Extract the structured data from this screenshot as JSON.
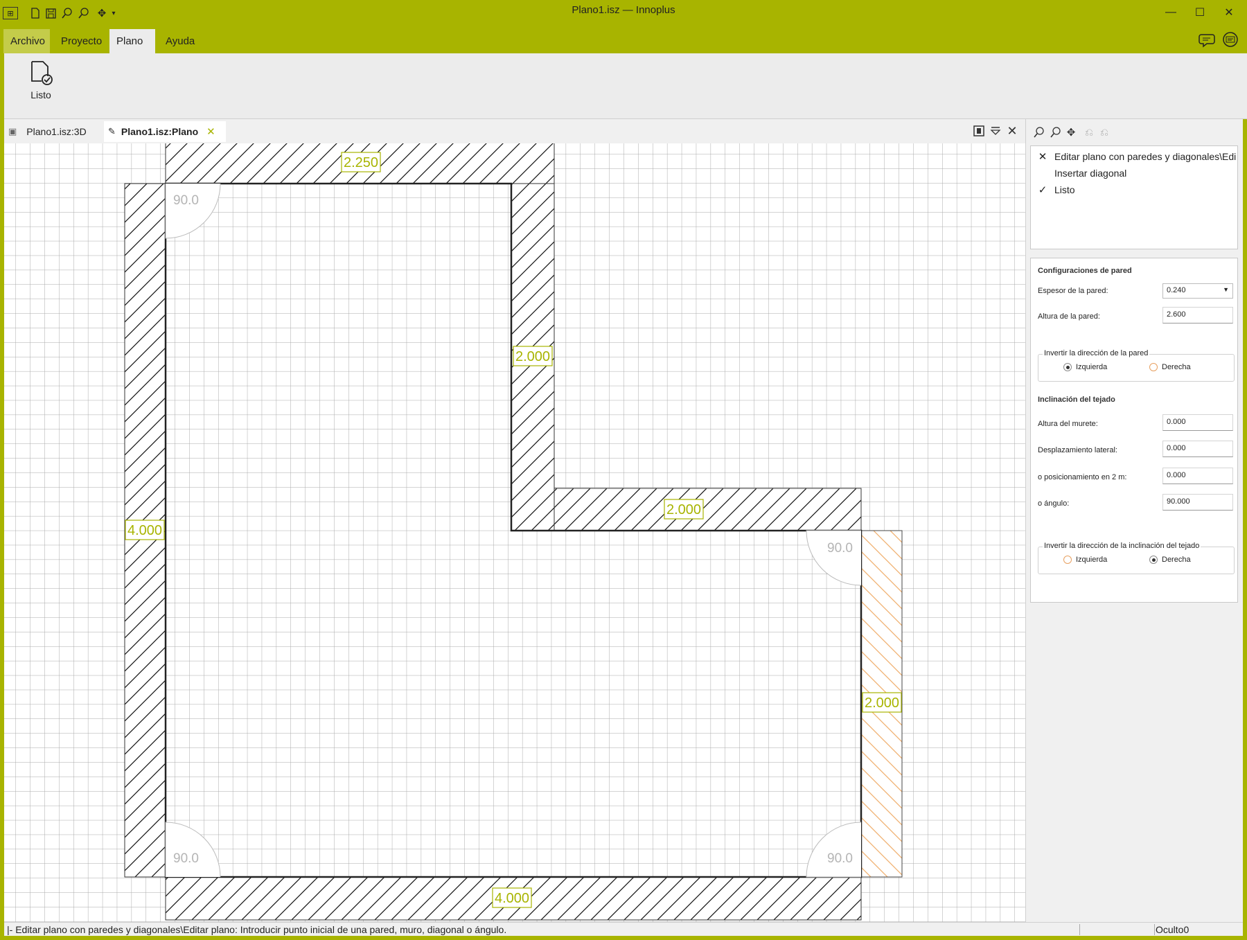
{
  "window": {
    "title": "Plano1.isz — Innoplus",
    "minimize": "—",
    "maximize": "☐",
    "close": "✕"
  },
  "quick_access": [
    "app-icon",
    "new-document-icon",
    "save-icon",
    "zoom-window-icon",
    "zoom-icon",
    "pan-icon",
    "more-dropdown-icon"
  ],
  "menu": {
    "tabs": [
      "Archivo",
      "Proyecto",
      "Plano",
      "Ayuda"
    ],
    "active": "Plano"
  },
  "ribbon": {
    "listo_label": "Listo"
  },
  "doc_tabs": {
    "tab1": "Plano1.isz:3D",
    "tab2": "Plano1.isz:Plano"
  },
  "plan": {
    "dimensions": {
      "top": "2.250",
      "right_upper": "2.000",
      "middle": "2.000",
      "left": "4.000",
      "right_lower": "2.000",
      "bottom": "4.000"
    },
    "angles": {
      "top_left": "90.0",
      "right_corner": "90.0",
      "bottom_left": "90.0",
      "bottom_right": "90.0"
    }
  },
  "tasks": [
    {
      "mark": "✕",
      "label": "Editar plano con paredes y diagonales\\Edi"
    },
    {
      "mark": "",
      "label": "Insertar diagonal"
    },
    {
      "mark": "✓",
      "label": "Listo"
    }
  ],
  "props": {
    "wall_section": "Configuraciones de pared",
    "thickness_label": "Espesor de la pared:",
    "thickness_value": "0.240",
    "height_label": "Altura de la pared:",
    "height_value": "2.600",
    "invert_wall_title": "Invertir la dirección de la pared",
    "left_option": "Izquierda",
    "right_option": "Derecha",
    "roof_section": "Inclinación del tejado",
    "knee_label": "Altura del murete:",
    "knee_value": "0.000",
    "lateral_label": "Desplazamiento lateral:",
    "lateral_value": "0.000",
    "pos_label": "o posicionamiento en 2 m:",
    "pos_value": "0.000",
    "angle_label": "o ángulo:",
    "angle_value": "90.000",
    "invert_roof_title": "Invertir la dirección de la inclinación del tejado",
    "wall_direction": "Izquierda",
    "roof_direction": "Derecha"
  },
  "status": {
    "text": "|- Editar plano con paredes y diagonales\\Editar plano: Introducir punto inicial de una pared, muro, diagonal o ángulo.",
    "right": "Oculto0"
  },
  "colors": {
    "accent": "#a8b400",
    "dimension": "#a8b400",
    "selected_wall": "#f0b070"
  }
}
